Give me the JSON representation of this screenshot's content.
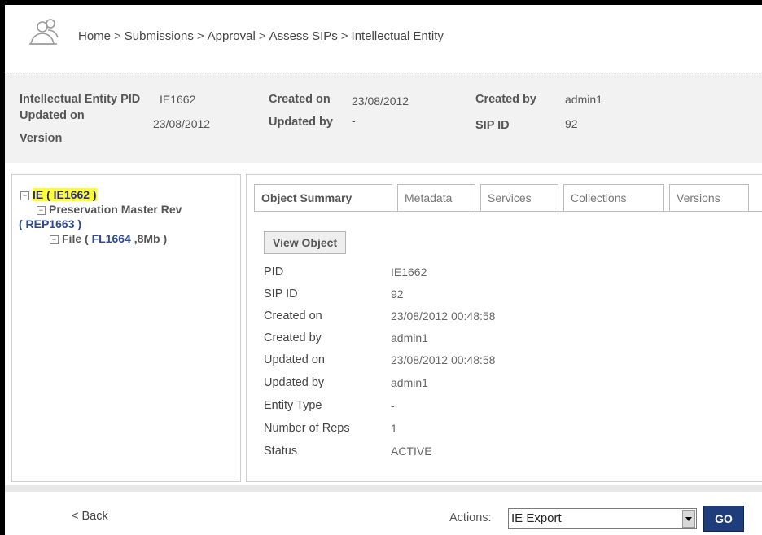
{
  "breadcrumb": [
    "Home",
    "Submissions",
    "Approval",
    "Assess SIPs",
    "Intellectual Entity"
  ],
  "breadcrumb_separator": ">",
  "entity_info": {
    "ie_pid_label": "Intellectual Entity PID",
    "ie_pid_value": "IE1662",
    "updated_on_label": "Updated on",
    "updated_on_value": "23/08/2012",
    "version_label": "Version",
    "created_on_label": "Created on",
    "created_on_value": "23/08/2012",
    "updated_by_label": "Updated by",
    "updated_by_value": "-",
    "created_by_label": "Created by",
    "created_by_value": "admin1",
    "sip_id_label": "SIP ID",
    "sip_id_value": "92"
  },
  "tree": {
    "ie_node": "IE ( IE1662 )",
    "rep_node_line1": "Preservation Master Rev",
    "rep_node_line2": "( REP1663 )",
    "file_prefix": "File (",
    "file_id": "FL1664",
    "file_suffix": ",8Mb )",
    "toggle_symbol": "−"
  },
  "tabs": [
    "Object Summary",
    "Metadata",
    "Services",
    "Collections",
    "Versions"
  ],
  "active_tab": "Object Summary",
  "view_object_label": "View Object",
  "summary": [
    {
      "label": "PID",
      "value": "IE1662"
    },
    {
      "label": "SIP ID",
      "value": "92"
    },
    {
      "label": "Created on",
      "value": "23/08/2012 00:48:58"
    },
    {
      "label": "Created by",
      "value": "admin1"
    },
    {
      "label": "Updated on",
      "value": "23/08/2012 00:48:58"
    },
    {
      "label": "Updated by",
      "value": "admin1"
    },
    {
      "label": "Entity Type",
      "value": "-"
    },
    {
      "label": "Number of Reps",
      "value": "1"
    },
    {
      "label": "Status",
      "value": "ACTIVE"
    }
  ],
  "footer": {
    "back_label": "< Back",
    "actions_label": "Actions:",
    "actions_selected": "IE Export",
    "go_label": "GO"
  },
  "colors": {
    "highlight": "#ffff33",
    "go_button": "#1f3d7a",
    "info_background": "#f2f2f2"
  }
}
